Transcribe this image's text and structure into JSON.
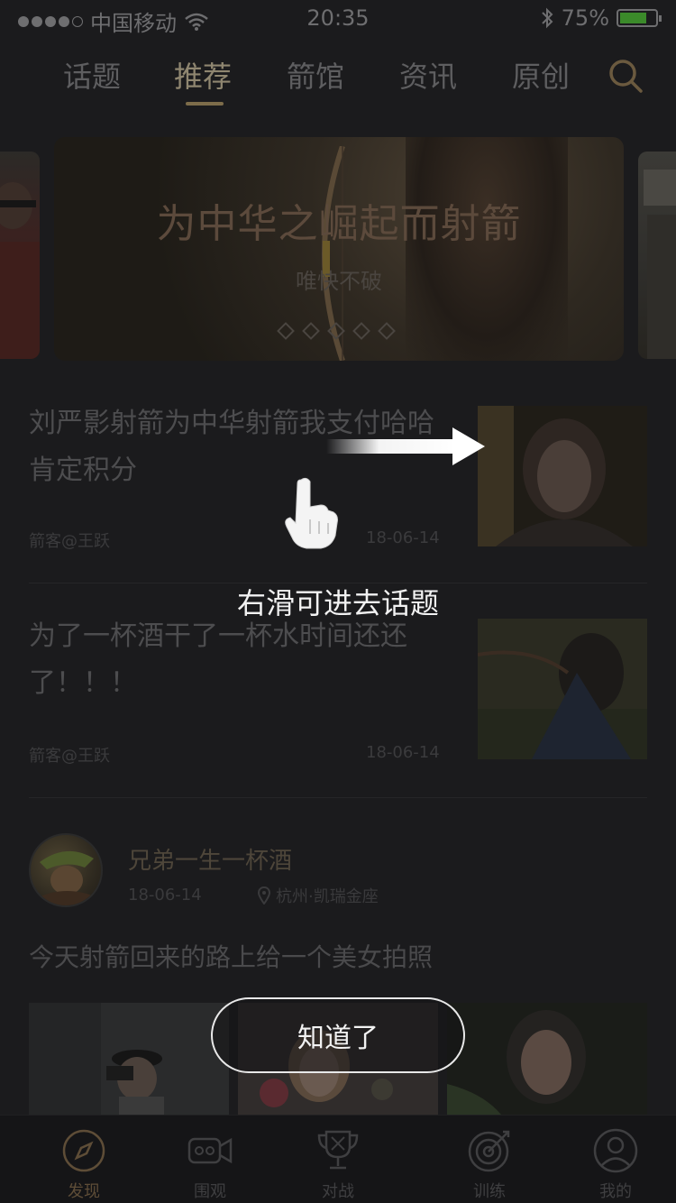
{
  "status_bar": {
    "carrier": "中国移动",
    "time": "20:35",
    "battery": "75%",
    "battery_level": 0.75
  },
  "tabs": [
    {
      "label": "话题"
    },
    {
      "label": "推荐",
      "active": true
    },
    {
      "label": "箭馆"
    },
    {
      "label": "资讯"
    },
    {
      "label": "原创"
    }
  ],
  "banner": {
    "title": "为中华之崛起而射箭",
    "subtitle": "唯快不破",
    "dot_count": 5
  },
  "articles": [
    {
      "title": "刘严影射箭为中华射箭我支付哈哈肯定积分",
      "author": "箭客@王跃",
      "date": "18-06-14"
    },
    {
      "title": "为了一杯酒干了一杯水时间还还了！！！",
      "author": "箭客@王跃",
      "date": "18-06-14"
    }
  ],
  "post": {
    "username": "兄弟一生一杯酒",
    "date": "18-06-14",
    "location": "杭州·凯瑞金座",
    "text": "今天射箭回来的路上给一个美女拍照"
  },
  "bottom_nav": [
    {
      "label": "发现",
      "icon": "compass-icon",
      "active": true
    },
    {
      "label": "围观",
      "icon": "video-camera-icon"
    },
    {
      "label": "对战",
      "icon": "trophy-icon"
    },
    {
      "label": "训练",
      "icon": "target-icon"
    },
    {
      "label": "我的",
      "icon": "user-icon"
    }
  ],
  "guide": {
    "hint": "右滑可进去话题",
    "button": "知道了"
  },
  "colors": {
    "accent": "#8f8670",
    "underline": "#7d6c4a",
    "overlay_text": "#f2f2f2"
  }
}
